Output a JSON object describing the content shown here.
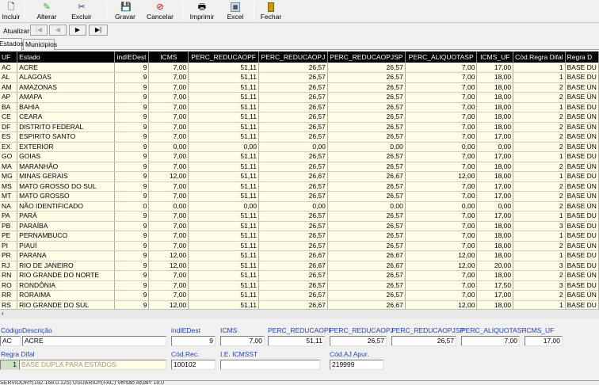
{
  "toolbar": {
    "incluir": "Incluir",
    "alterar": "Alterar",
    "excluir": "Excluir",
    "gravar": "Gravar",
    "cancelar": "Cancelar",
    "imprimir": "Imprimir",
    "excel": "Excel",
    "fechar": "Fechar"
  },
  "nav": {
    "atualizar": "Atualizar",
    "first": "|◀",
    "prev": "◀",
    "next": "▶",
    "last": "▶|"
  },
  "tabs": [
    "Estados",
    "Municipios"
  ],
  "grid": {
    "columns": [
      "UF",
      "Estado",
      "indIEDest",
      "ICMS",
      "PERC_REDUCAOPF",
      "PERC_REDUCAOPJ",
      "PERC_REDUCAOPJSP",
      "PERC_ALIQUOTASP",
      "ICMS_UF",
      "Cód.Regra Difal",
      "Regra D"
    ],
    "rows": [
      [
        "AC",
        "ACRE",
        "9",
        "7,00",
        "51,11",
        "26,57",
        "26,57",
        "7,00",
        "17,00",
        "1",
        "BASE DU"
      ],
      [
        "AL",
        "ALAGOAS",
        "9",
        "7,00",
        "51,11",
        "26,57",
        "26,57",
        "7,00",
        "18,00",
        "1",
        "BASE DU"
      ],
      [
        "AM",
        "AMAZONAS",
        "9",
        "7,00",
        "51,11",
        "26,57",
        "26,57",
        "7,00",
        "18,00",
        "2",
        "BASE ÚN"
      ],
      [
        "AP",
        "AMAPA",
        "9",
        "7,00",
        "51,11",
        "26,57",
        "26,57",
        "7,00",
        "18,00",
        "2",
        "BASE ÚN"
      ],
      [
        "BA",
        "BAHIA",
        "9",
        "7,00",
        "51,11",
        "26,57",
        "26,57",
        "7,00",
        "18,00",
        "1",
        "BASE DU"
      ],
      [
        "CE",
        "CEARA",
        "9",
        "7,00",
        "51,11",
        "26,57",
        "26,57",
        "7,00",
        "18,00",
        "2",
        "BASE ÚN"
      ],
      [
        "DF",
        "DISTRITO FEDERAL",
        "9",
        "7,00",
        "51,11",
        "26,57",
        "26,57",
        "7,00",
        "18,00",
        "2",
        "BASE ÚN"
      ],
      [
        "ES",
        "ESPIRITO SANTO",
        "9",
        "7,00",
        "51,11",
        "26,57",
        "26,57",
        "7,00",
        "17,00",
        "2",
        "BASE ÚN"
      ],
      [
        "EX",
        "EXTERIOR",
        "9",
        "0,00",
        "0,00",
        "0,00",
        "0,00",
        "0,00",
        "0,00",
        "2",
        "BASE ÚN"
      ],
      [
        "GO",
        "GOIAS",
        "9",
        "7,00",
        "51,11",
        "26,57",
        "26,57",
        "7,00",
        "17,00",
        "1",
        "BASE DU"
      ],
      [
        "MA",
        "MARANHÃO",
        "9",
        "7,00",
        "51,11",
        "26,57",
        "26,57",
        "7,00",
        "18,00",
        "2",
        "BASE ÚN"
      ],
      [
        "MG",
        "MINAS GERAIS",
        "9",
        "12,00",
        "51,11",
        "26,67",
        "26,67",
        "12,00",
        "18,00",
        "1",
        "BASE DU"
      ],
      [
        "MS",
        "MATO GROSSO DO SUL",
        "9",
        "7,00",
        "51,11",
        "26,57",
        "26,57",
        "7,00",
        "17,00",
        "2",
        "BASE ÚN"
      ],
      [
        "MT",
        "MATO GROSSO",
        "9",
        "7,00",
        "51,11",
        "26,57",
        "26,57",
        "7,00",
        "17,00",
        "2",
        "BASE ÚN"
      ],
      [
        "NA",
        "NÃO IDENTIFICADO",
        "0",
        "0,00",
        "0,00",
        "0,00",
        "0,00",
        "0,00",
        "0,00",
        "2",
        "BASE ÚN"
      ],
      [
        "PA",
        "PARÁ",
        "9",
        "7,00",
        "51,11",
        "26,57",
        "26,57",
        "7,00",
        "17,00",
        "1",
        "BASE DU"
      ],
      [
        "PB",
        "PARAÍBA",
        "9",
        "7,00",
        "51,11",
        "26,57",
        "26,57",
        "7,00",
        "18,00",
        "3",
        "BASE DU"
      ],
      [
        "PE",
        "PERNAMBUCO",
        "9",
        "7,00",
        "51,11",
        "26,57",
        "26,57",
        "7,00",
        "18,00",
        "1",
        "BASE DU"
      ],
      [
        "PI",
        "PIAUÍ",
        "9",
        "7,00",
        "51,11",
        "26,57",
        "26,57",
        "7,00",
        "18,00",
        "2",
        "BASE ÚN"
      ],
      [
        "PR",
        "PARANA",
        "9",
        "12,00",
        "51,11",
        "26,67",
        "26,67",
        "12,00",
        "18,00",
        "1",
        "BASE DU"
      ],
      [
        "RJ",
        "RIO DE JANEIRO",
        "9",
        "12,00",
        "51,11",
        "26,67",
        "26,67",
        "12,00",
        "20,00",
        "3",
        "BASE DU"
      ],
      [
        "RN",
        "RIO GRANDE DO NORTE",
        "9",
        "7,00",
        "51,11",
        "26,57",
        "26,57",
        "7,00",
        "18,00",
        "2",
        "BASE ÚN"
      ],
      [
        "RO",
        "RONDÔNIA",
        "9",
        "7,00",
        "51,11",
        "26,57",
        "26,57",
        "7,00",
        "17,50",
        "3",
        "BASE DU"
      ],
      [
        "RR",
        "RORAIMA",
        "9",
        "7,00",
        "51,11",
        "26,57",
        "26,57",
        "7,00",
        "17,00",
        "2",
        "BASE ÚN"
      ],
      [
        "RS",
        "RIO GRANDE DO SUL",
        "9",
        "12,00",
        "51,11",
        "26,67",
        "26,67",
        "12,00",
        "18,00",
        "1",
        "BASE DU"
      ]
    ]
  },
  "detail": {
    "codigo_label": "Código",
    "descricao_label": "Descrição",
    "indiedest_label": "indIEDest",
    "icms_label": "ICMS",
    "perc_pf_label": "PERC_REDUCAOPF",
    "perc_pj_label": "PERC_REDUCAOPJ",
    "perc_pjsp_label": "PERC_REDUCAOPJSP",
    "perc_aliq_label": "PERC_ALIQUOTASP",
    "icms_uf_label": "ICMS_UF",
    "codigo": "AC",
    "descricao": "ACRE",
    "indiedest": "9",
    "icms": "7,00",
    "perc_pf": "51,11",
    "perc_pj": "26,57",
    "perc_pjsp": "26,57",
    "perc_aliq": "7,00",
    "icms_uf": "17,00",
    "regra_difal_label": "Regra Difal",
    "regra_difal_cod": "1",
    "regra_difal_desc": "BASE DUPLA  PARA ESTADOS",
    "cod_rec_label": "Cód.Rec.",
    "cod_rec": "100102",
    "ie_icmsst_label": "I.E. ICMSST",
    "ie_icmsst": "",
    "cod_aj_label": "Cód.AJ Apur.",
    "cod_aj": "219999"
  },
  "status": "SERVIDOR=(192.168.0.125) USUARIO=(FAC) Versão Atual= 18.0"
}
